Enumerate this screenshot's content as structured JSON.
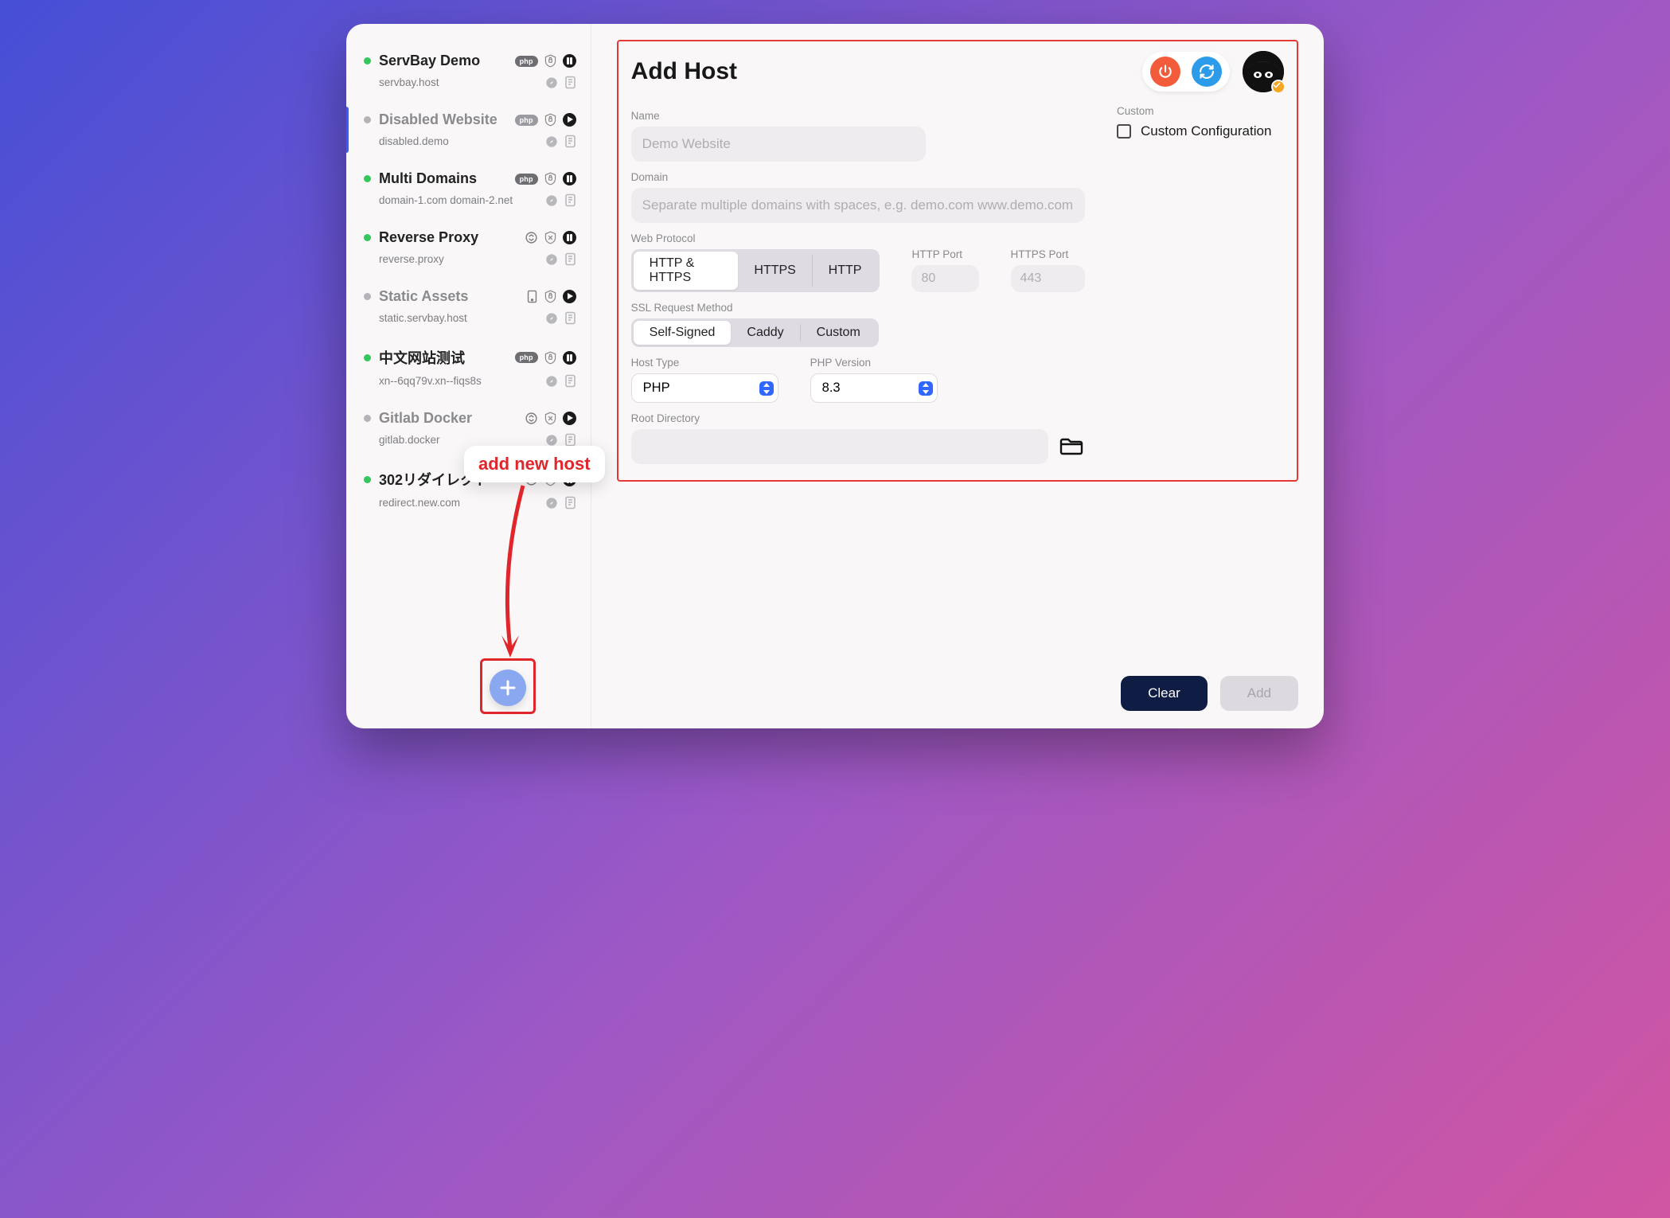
{
  "sidebar": {
    "items": [
      {
        "title": "ServBay Demo",
        "domain": "servbay.host",
        "status": "green",
        "type": "php",
        "action": "pause"
      },
      {
        "title": "Disabled Website",
        "domain": "disabled.demo",
        "status": "gray",
        "type": "php",
        "action": "play",
        "disabled": true,
        "selected": true
      },
      {
        "title": "Multi Domains",
        "domain": "domain-1.com domain-2.net",
        "status": "green",
        "type": "php",
        "action": "pause"
      },
      {
        "title": "Reverse Proxy",
        "domain": "reverse.proxy",
        "status": "green",
        "type": "proxy",
        "action": "pause"
      },
      {
        "title": "Static Assets",
        "domain": "static.servbay.host",
        "status": "gray",
        "type": "static",
        "action": "play",
        "disabled": true
      },
      {
        "title": "中文网站测试",
        "domain": "xn--6qq79v.xn--fiqs8s",
        "status": "green",
        "type": "php",
        "action": "pause"
      },
      {
        "title": "Gitlab Docker",
        "domain": "gitlab.docker",
        "status": "gray",
        "type": "proxy",
        "action": "play",
        "disabled": true
      },
      {
        "title": "302リダイレクト",
        "domain": "redirect.new.com",
        "status": "green",
        "type": "redirect",
        "action": "pause"
      }
    ]
  },
  "form": {
    "title": "Add Host",
    "labels": {
      "name": "Name",
      "domain": "Domain",
      "web_protocol": "Web Protocol",
      "http_port": "HTTP Port",
      "https_port": "HTTPS Port",
      "ssl_method": "SSL Request Method",
      "host_type": "Host Type",
      "php_version": "PHP Version",
      "root_dir": "Root Directory",
      "custom_section": "Custom",
      "custom_config": "Custom Configuration"
    },
    "placeholders": {
      "name": "Demo Website",
      "domain": "Separate multiple domains with spaces, e.g. demo.com www.demo.com",
      "http_port": "80",
      "https_port": "443"
    },
    "protocol_options": [
      "HTTP & HTTPS",
      "HTTPS",
      "HTTP"
    ],
    "protocol_selected": "HTTP & HTTPS",
    "ssl_options": [
      "Self-Signed",
      "Caddy",
      "Custom"
    ],
    "ssl_selected": "Self-Signed",
    "host_type_value": "PHP",
    "php_version_value": "8.3"
  },
  "footer": {
    "clear": "Clear",
    "add": "Add"
  },
  "annotation": {
    "callout": "add new host"
  }
}
